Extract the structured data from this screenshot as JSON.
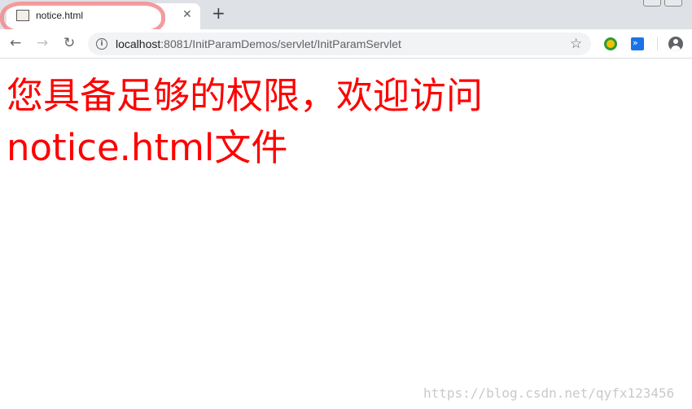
{
  "browser": {
    "tab": {
      "title": "notice.html",
      "close_glyph": "✕",
      "favicon": "page-thumbnail-icon"
    },
    "new_tab_glyph": "+",
    "toolbar": {
      "back_glyph": "←",
      "forward_glyph": "→",
      "reload_glyph": "↻",
      "info_glyph": "i",
      "url_host": "localhost",
      "url_rest": ":8081/InitParamDemos/servlet/InitParamServlet",
      "bookmark_glyph": "☆",
      "extension2_glyph": "»"
    }
  },
  "page": {
    "message": "您具备足够的权限，欢迎访问notice.html文件",
    "text_color": "#ff0000"
  },
  "watermark": "https://blog.csdn.net/qyfx123456",
  "colors": {
    "tabstrip": "#dee1e6",
    "omnibox": "#f1f3f4",
    "annotation_circle": "#f28b8b"
  }
}
